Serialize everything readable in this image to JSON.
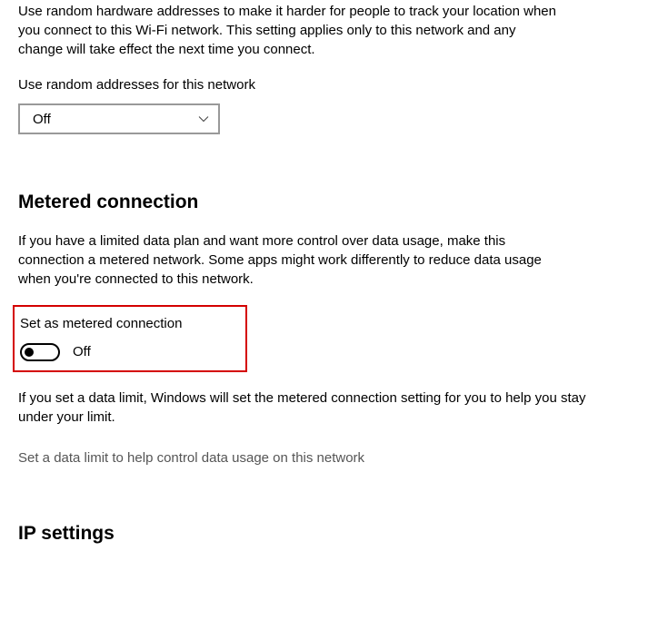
{
  "random_hw": {
    "description": "Use random hardware addresses to make it harder for people to track your location when you connect to this Wi-Fi network. This setting applies only to this network and any change will take effect the next time you connect.",
    "label": "Use random addresses for this network",
    "value": "Off"
  },
  "metered": {
    "heading": "Metered connection",
    "description": "If you have a limited data plan and want more control over data usage, make this connection a metered network. Some apps might work differently to reduce data usage when you're connected to this network.",
    "toggle_label": "Set as metered connection",
    "toggle_state": "Off",
    "helper": "If you set a data limit, Windows will set the metered connection setting for you to help you stay under your limit.",
    "link": "Set a data limit to help control data usage on this network"
  },
  "ip": {
    "heading": "IP settings"
  }
}
